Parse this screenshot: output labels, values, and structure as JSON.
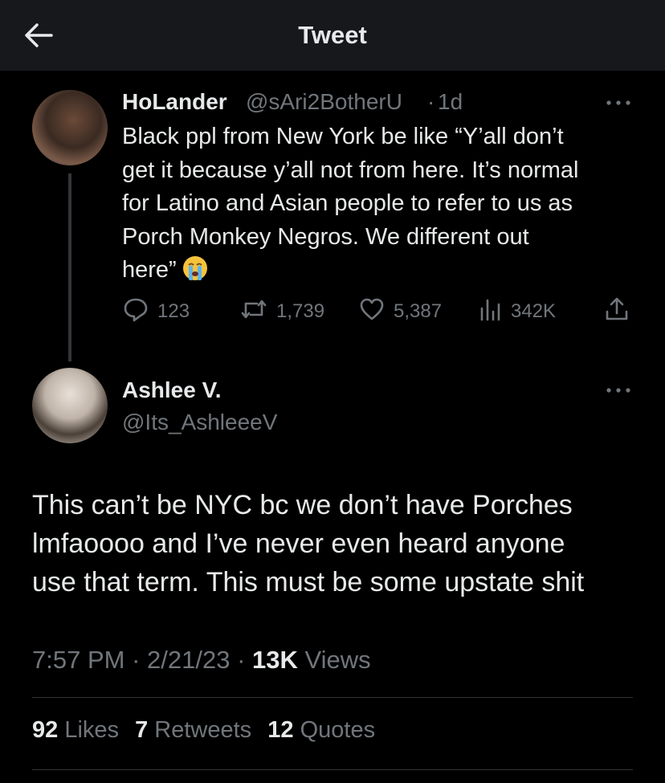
{
  "header": {
    "title": "Tweet"
  },
  "quoted_tweet": {
    "display_name": "HoLander",
    "handle": "@sAri2BotherU",
    "separator": "·",
    "time": "1d",
    "text_lines": [
      "Black ppl from New York be like “Y’all don’t",
      "get it because y’all not from here. It’s normal",
      "for Latino and Asian people to refer to us as",
      "Porch Monkey Negros. We different out",
      "here”"
    ],
    "emoji": "crying-face-emoji",
    "actions": {
      "replies": "123",
      "retweets": "1,739",
      "likes": "5,387",
      "views": "342K"
    }
  },
  "main_tweet": {
    "display_name": "Ashlee V.",
    "handle": "@Its_AshleeeV",
    "text_lines": [
      "This can’t be NYC bc we don’t have Porches",
      "lmfaoooo and I’ve never even heard anyone",
      "use that term. This must be some upstate shit"
    ],
    "time": "7:57 PM",
    "date": "2/21/23",
    "sep": "·",
    "views_count": "13K",
    "views_label": "Views",
    "stats": {
      "likes_count": "92",
      "likes_label": "Likes",
      "retweets_count": "7",
      "retweets_label": "Retweets",
      "quotes_count": "12",
      "quotes_label": "Quotes"
    }
  },
  "colors": {
    "background": "#000000",
    "text": "#e7e9ea",
    "muted": "#71767b",
    "header_bg": "#16181c"
  }
}
